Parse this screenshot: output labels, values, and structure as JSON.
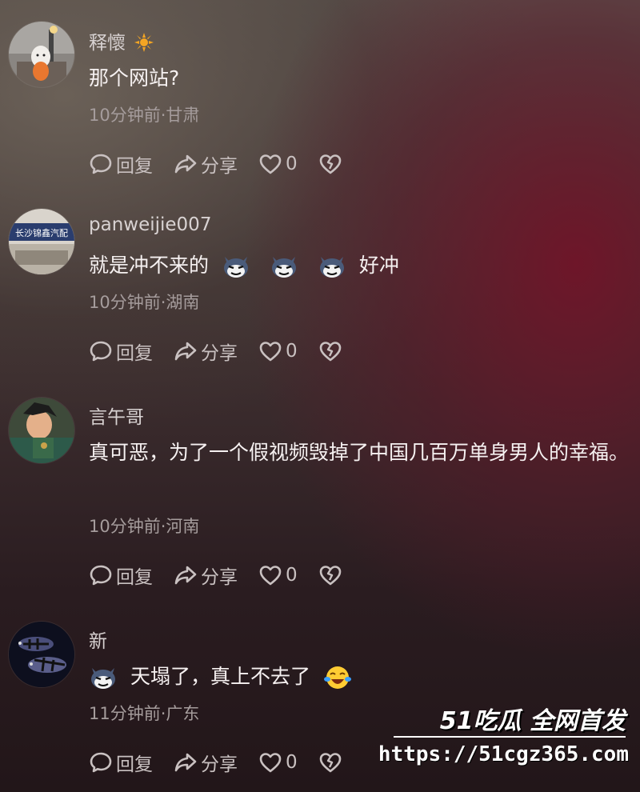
{
  "comments": [
    {
      "username": "释懷",
      "badge": "sun",
      "text": "那个网站?",
      "meta": "10分钟前·甘肃",
      "reply": "回复",
      "share": "分享",
      "likes": "0"
    },
    {
      "username": "panweijie007",
      "avatar_text": "长沙锦鑫汽配",
      "text": "就是冲不来的",
      "text_suffix": "好冲",
      "meta": "10分钟前·湖南",
      "reply": "回复",
      "share": "分享",
      "likes": "0"
    },
    {
      "username": "言午哥",
      "text": "真可恶，为了一个假视频毁掉了中国几百万单身男人的幸福。",
      "meta": "10分钟前·河南",
      "reply": "回复",
      "share": "分享",
      "likes": "0"
    },
    {
      "username": "新",
      "text": "天塌了，真上不去了",
      "meta": "11分钟前·广东",
      "reply": "回复",
      "share": "分享",
      "likes": "0"
    }
  ],
  "watermark": {
    "brand": "51吃瓜 全网首发",
    "url": "https://51cgz365.com"
  },
  "colors": {
    "text": "#f6f1f1",
    "meta": "#a59c9c",
    "accent": "#7a1a2c"
  },
  "icons": [
    "comment-icon",
    "share-icon",
    "heart-icon",
    "broken-heart-icon",
    "sun-icon",
    "cat-emoji",
    "crying-laughing-emoji"
  ]
}
